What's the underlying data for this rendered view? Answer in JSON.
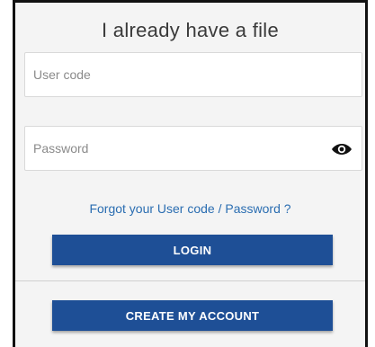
{
  "login_panel": {
    "title": "I already have a file",
    "user_code_placeholder": "User code",
    "password_placeholder": "Password",
    "password_visibility_icon": "eye-icon",
    "forgot_link": "Forgot your User code / Password ?",
    "login_button": "LOGIN",
    "create_account_button": "CREATE MY ACCOUNT"
  },
  "colors": {
    "primary_button": "#1e4f96",
    "link": "#2a6db1",
    "panel_background": "#f4f4f4"
  }
}
